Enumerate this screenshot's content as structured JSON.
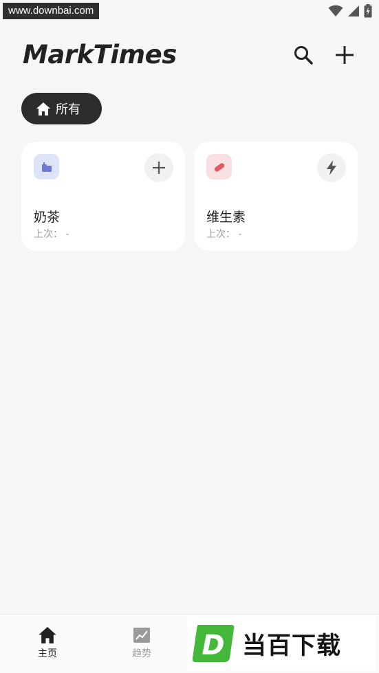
{
  "status_bar": {
    "watermark_url": "www.downbai.com",
    "icons": [
      "wifi-icon",
      "cell-signal-icon",
      "battery-charging-icon"
    ]
  },
  "header": {
    "title": "MarkTimes",
    "icons": [
      "search-icon",
      "plus-icon"
    ]
  },
  "filter": {
    "label": "所有",
    "icon": "home-icon"
  },
  "cards": [
    {
      "name": "奶茶",
      "last": "上次：  -",
      "icon": "drink-icon",
      "action_icon": "plus-icon",
      "icon_bg": "#dfe3f7",
      "icon_color": "#6b78d6"
    },
    {
      "name": "维生素",
      "last": "上次：  -",
      "icon": "pill-icon",
      "action_icon": "lightning-icon",
      "icon_bg": "#f8dfe1",
      "icon_color": "#e05a66"
    }
  ],
  "bottom_nav": {
    "items": [
      {
        "label": "主页",
        "icon": "home-icon",
        "active": true
      },
      {
        "label": "趋势",
        "icon": "trend-chart-icon",
        "active": false
      }
    ]
  },
  "logo_watermark": {
    "letter": "D",
    "text": "当百下载"
  },
  "colors": {
    "background": "#f6f6f6",
    "chip": "#2c2c2c",
    "card": "#ffffff"
  }
}
